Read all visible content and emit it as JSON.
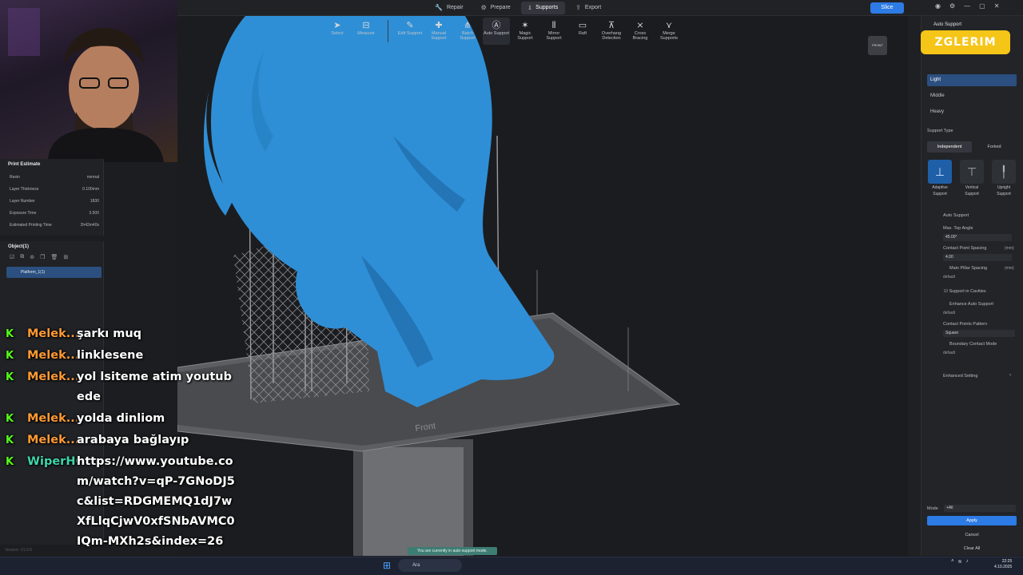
{
  "top_nav": [
    {
      "icon": "wrench-icon",
      "label": "Repair"
    },
    {
      "icon": "gear-icon",
      "label": "Prepare"
    },
    {
      "icon": "support-icon",
      "label": "Supports"
    },
    {
      "icon": "export-icon",
      "label": "Export"
    }
  ],
  "slice_label": "Slice",
  "toolbar": [
    {
      "label": "Select"
    },
    {
      "label": "Measure"
    },
    {
      "label": "Edit Support"
    },
    {
      "label": "Manual Support"
    },
    {
      "label": "Batch Support"
    },
    {
      "label": "Auto Support"
    },
    {
      "label": "Magic Support"
    },
    {
      "label": "Mirror Support"
    },
    {
      "label": "Raft"
    },
    {
      "label": "Overhang Detection"
    },
    {
      "label": "Cross Bracing"
    },
    {
      "label": "Merge Supports"
    }
  ],
  "cube_label": "FRONT",
  "plate_label": "Front",
  "estimate": {
    "title": "Print Estimate",
    "rows": [
      {
        "k": "Resin",
        "v": "normal"
      },
      {
        "k": "Layer Thickness",
        "v": "0.100mm"
      },
      {
        "k": "Layer Number",
        "v": "1830"
      },
      {
        "k": "Exposure Time",
        "v": "3.500"
      },
      {
        "k": "Estimated Printing Time",
        "v": "2h42m40s"
      }
    ]
  },
  "objects": {
    "title": "Object(1)",
    "item": "Platform_1(1)"
  },
  "version": "Version: V1.0.0",
  "chat": [
    {
      "user": "Melek...",
      "msg": "şarkı muq"
    },
    {
      "user": "Melek...",
      "msg": "linklesene"
    },
    {
      "user": "Melek...",
      "msg": "yol lsiteme atim youtubede"
    },
    {
      "user": "Melek...",
      "msg": "yolda dinliom"
    },
    {
      "user": "Melek...",
      "msg": "arabaya bağlayıp"
    },
    {
      "user": "WiperHG",
      "msg": "https://www.youtube.com/watch?v=qP-7GNoDJ5c&list=RDGMEMQ1dJ7wXfLlqCjwV0xfSNbAVMC0IQm-MXh2s&index=26"
    }
  ],
  "right_panel": {
    "title": "Auto Support",
    "logo": "ZGLERIM",
    "density": [
      "Light",
      "Middle",
      "Heavy"
    ],
    "support_type_label": "Support Type",
    "tabs": [
      "Independent",
      "Forked"
    ],
    "types": [
      {
        "l1": "Adaptive",
        "l2": "Support"
      },
      {
        "l1": "Vertical",
        "l2": "Support"
      },
      {
        "l1": "Upright",
        "l2": "Support"
      }
    ],
    "auto_support_label": "Auto Support",
    "max_top_angle": {
      "label": "Max. Top Angle",
      "value": "45.00°"
    },
    "contact_spacing": {
      "label": "Contact Point Spacing",
      "unit": "(mm)",
      "value": "4.00"
    },
    "pillar_spacing": {
      "label": "Main Pillar Spacing",
      "unit": "(mm)",
      "value": "default"
    },
    "support_cavities": "Support in Cavities",
    "enhance": {
      "label": "Enhance Auto Support",
      "value": "default"
    },
    "pattern": {
      "label": "Contact Points Pattern",
      "value": "Square"
    },
    "boundary": {
      "label": "Boundary Contact Mode",
      "value": "default"
    },
    "enhanced_setting": "Enhanced Setting",
    "mode": {
      "label": "Mode",
      "value": "+All"
    },
    "apply": "Apply",
    "cancel": "Cancel",
    "clear": "Clear All"
  },
  "banner": "You are currently in auto-support mode.",
  "taskbar": {
    "search": "Ara",
    "time": "22:25",
    "date": "4.10.2025"
  },
  "colors": {
    "accent": "#2d7be5",
    "model": "#2e8fd6",
    "support": "#8e9196",
    "kick": "#53fc18",
    "chat_user": "#ff9a33"
  }
}
